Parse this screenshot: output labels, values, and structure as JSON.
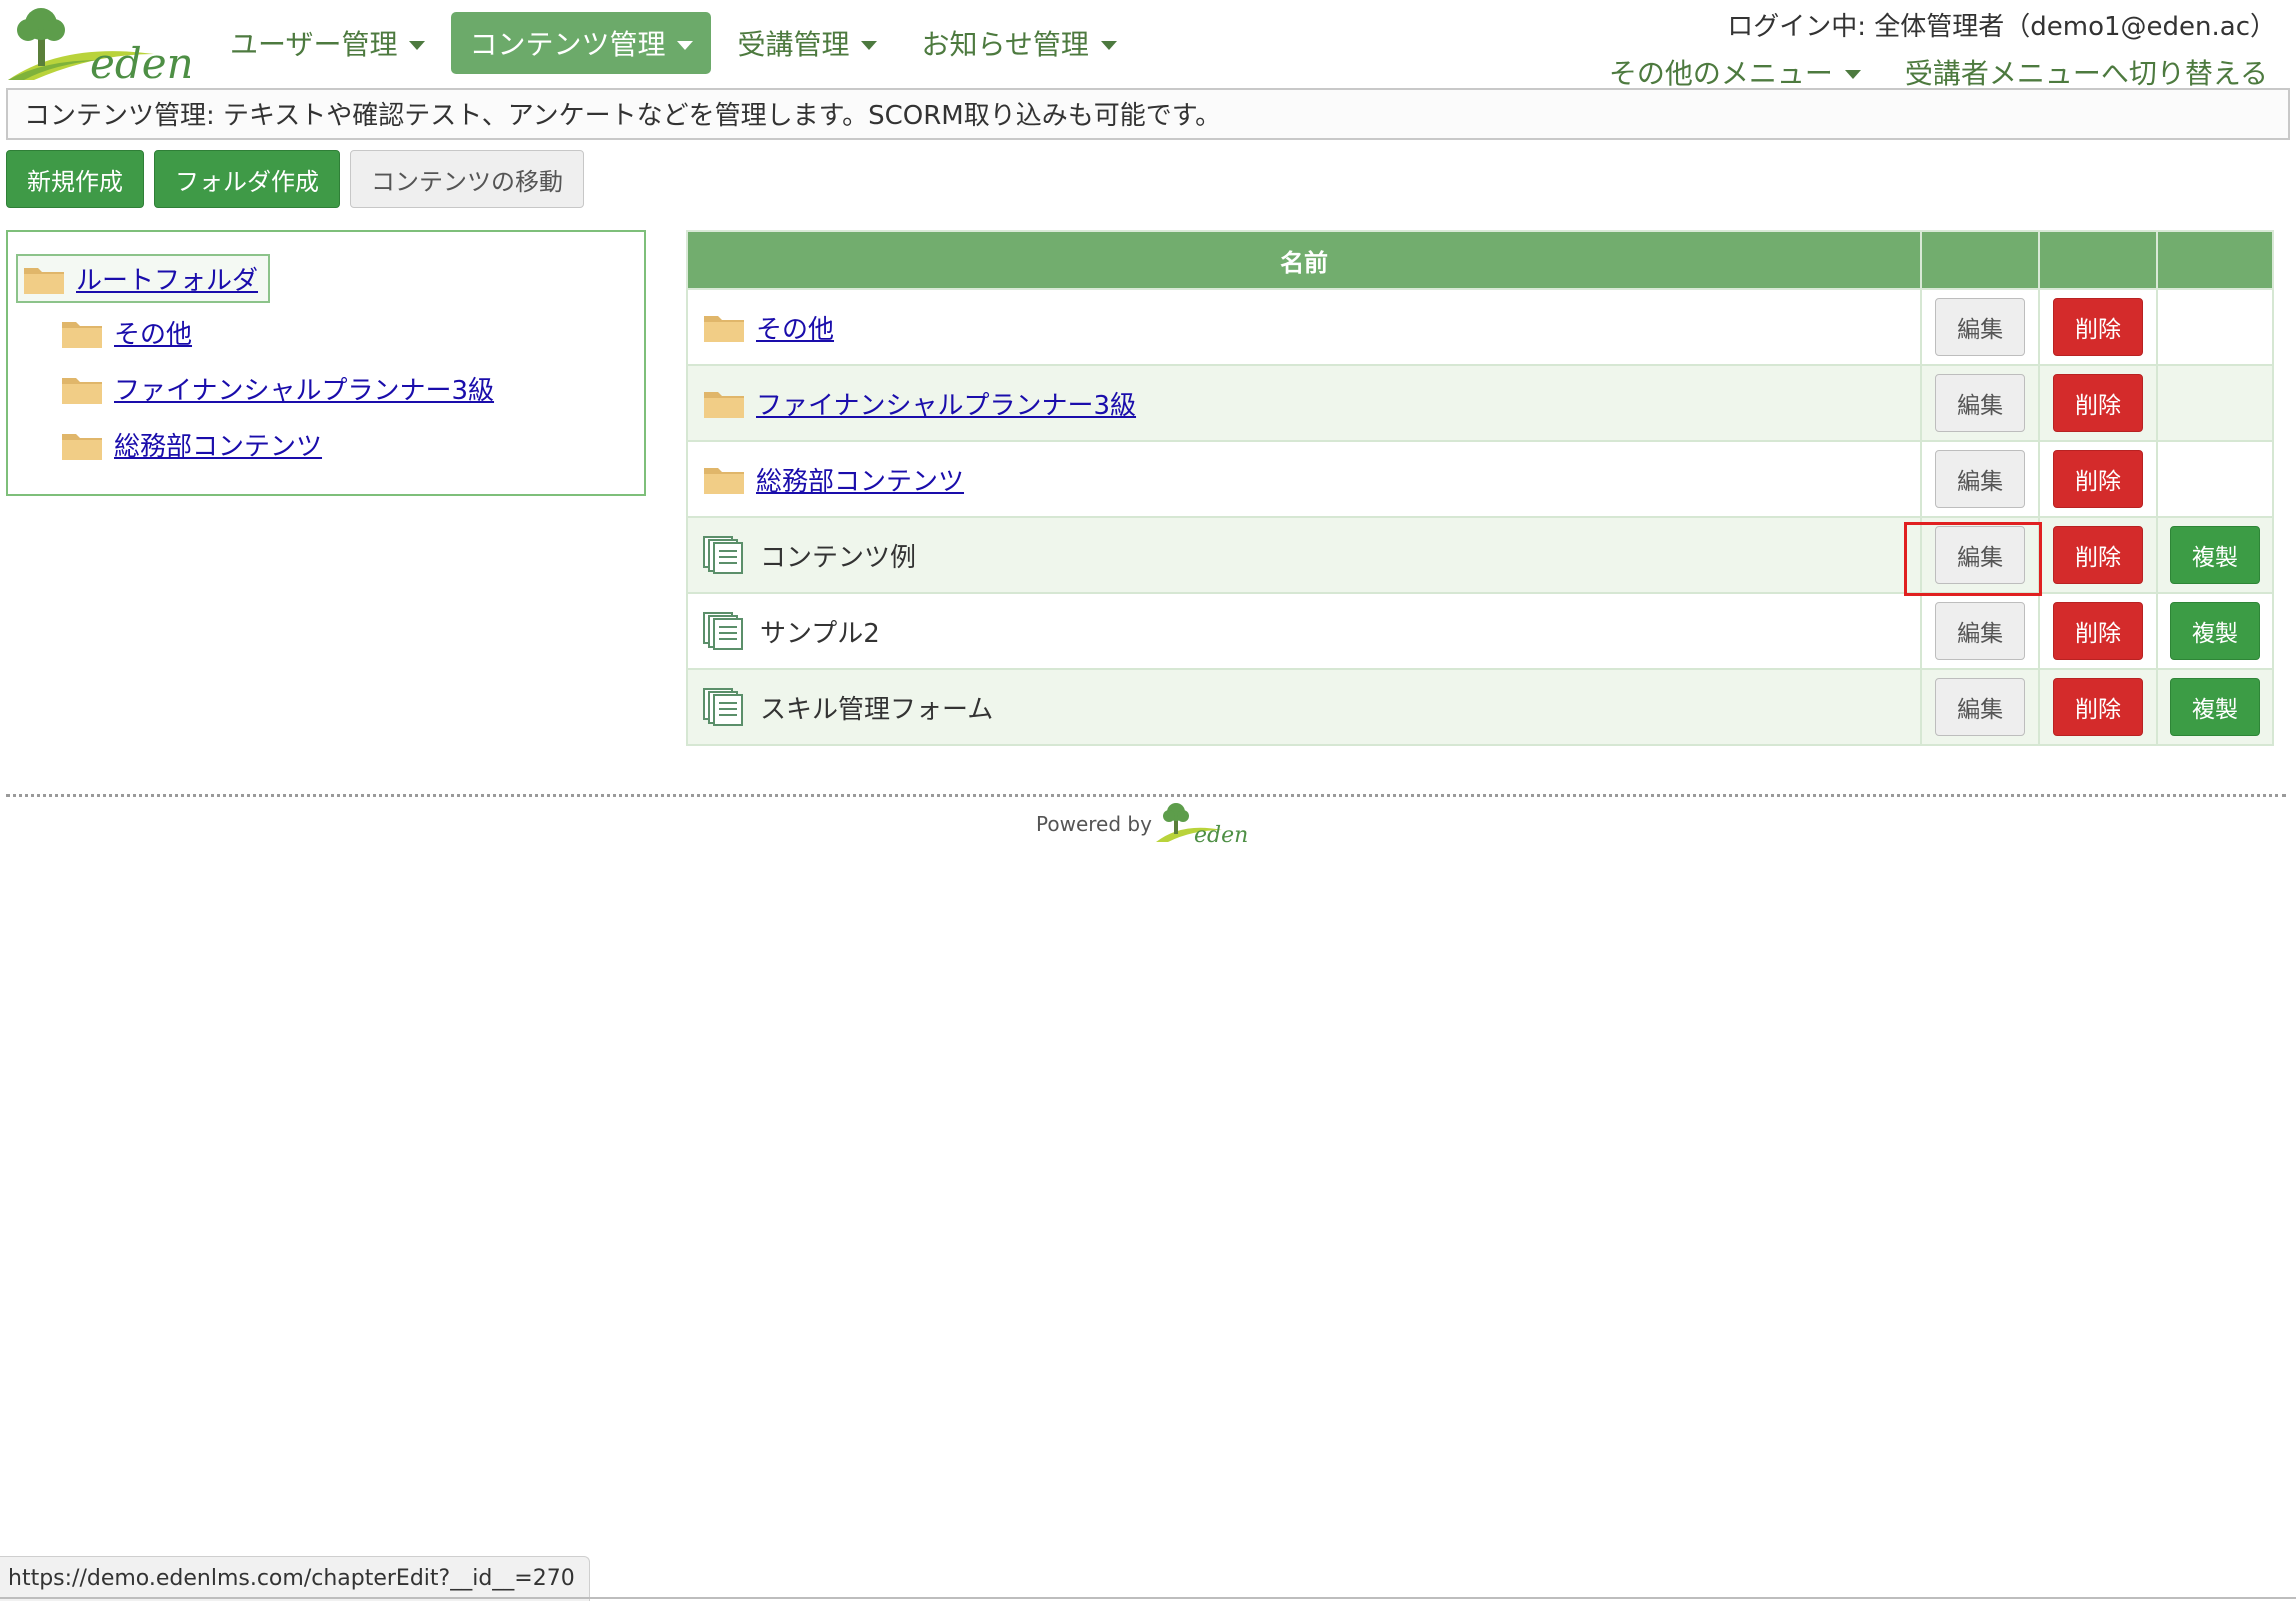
{
  "header": {
    "logo_text": "eden",
    "nav": [
      {
        "label": "ユーザー管理",
        "active": false
      },
      {
        "label": "コンテンツ管理",
        "active": true
      },
      {
        "label": "受講管理",
        "active": false
      },
      {
        "label": "お知らせ管理",
        "active": false
      }
    ],
    "login_info": "ログイン中: 全体管理者（demo1@eden.ac）",
    "other_menu": "その他のメニュー",
    "switch_menu": "受講者メニューへ切り替える"
  },
  "description": "コンテンツ管理: テキストや確認テスト、アンケートなどを管理します。SCORM取り込みも可能です。",
  "toolbar": {
    "new": "新規作成",
    "new_folder": "フォルダ作成",
    "move": "コンテンツの移動"
  },
  "tree": {
    "root": "ルートフォルダ",
    "children": [
      "その他",
      "ファイナンシャルプランナー3級",
      "総務部コンテンツ"
    ]
  },
  "table": {
    "header_name": "名前",
    "edit_label": "編集",
    "delete_label": "削除",
    "copy_label": "複製",
    "rows": [
      {
        "name": "その他",
        "kind": "folder"
      },
      {
        "name": "ファイナンシャルプランナー3級",
        "kind": "folder"
      },
      {
        "name": "総務部コンテンツ",
        "kind": "folder"
      },
      {
        "name": "コンテンツ例",
        "kind": "content"
      },
      {
        "name": "サンプル2",
        "kind": "content"
      },
      {
        "name": "スキル管理フォーム",
        "kind": "content"
      }
    ]
  },
  "footer": {
    "powered_by": "Powered by",
    "logo_text": "eden"
  },
  "status_url": "https://demo.edenlms.com/chapterEdit?__id__=270",
  "colors": {
    "brand_green": "#6caa6a",
    "button_green": "#3f9a47",
    "danger_red": "#d42b2b",
    "highlight_red": "#e02020"
  }
}
